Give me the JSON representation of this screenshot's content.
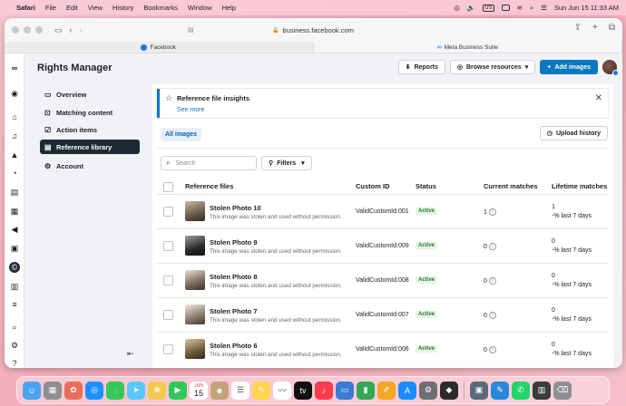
{
  "menubar": {
    "app": "Safari",
    "items": [
      "File",
      "Edit",
      "View",
      "History",
      "Bookmarks",
      "Window",
      "Help"
    ],
    "datetime": "Sun Jun 15  11:33 AM"
  },
  "browser": {
    "url": "business.facebook.com",
    "tabs": [
      "Facebook",
      "Meta Business Suite"
    ]
  },
  "app": {
    "title": "Rights Manager",
    "nav": [
      "Overview",
      "Matching content",
      "Action items",
      "Reference library",
      "Account"
    ],
    "actions": {
      "reports": "Reports",
      "browse": "Browse resources",
      "add": "Add images"
    }
  },
  "insight": {
    "title": "Reference file insights",
    "link": "See more"
  },
  "filters": {
    "chip": "All images",
    "upload": "Upload history",
    "search_placeholder": "Search",
    "filters": "Filters"
  },
  "table": {
    "headers": [
      "Reference files",
      "Custom ID",
      "Status",
      "Current matches",
      "Lifetime matches"
    ],
    "rows": [
      {
        "title": "Stolen Photo 10",
        "desc": "This image was stolen and used without permission.",
        "id": "ValidCustomId:001",
        "status": "Active",
        "current": "1",
        "lifetime": "1",
        "trend": "-% last 7 days"
      },
      {
        "title": "Stolen Photo 9",
        "desc": "This image was stolen and used without permission.",
        "id": "ValidCustomId:009",
        "status": "Active",
        "current": "0",
        "lifetime": "0",
        "trend": "-% last 7 days"
      },
      {
        "title": "Stolen Photo 8",
        "desc": "This image was stolen and used without permission.",
        "id": "ValidCustomId:008",
        "status": "Active",
        "current": "0",
        "lifetime": "0",
        "trend": "-% last 7 days"
      },
      {
        "title": "Stolen Photo 7",
        "desc": "This image was stolen and used without permission.",
        "id": "ValidCustomId:007",
        "status": "Active",
        "current": "0",
        "lifetime": "0",
        "trend": "-% last 7 days"
      },
      {
        "title": "Stolen Photo 6",
        "desc": "This image was stolen and used without permission.",
        "id": "ValidCustomId:006",
        "status": "Active",
        "current": "0",
        "lifetime": "0",
        "trend": "-% last 7 days"
      }
    ]
  },
  "dock": {
    "calendar_month": "JUN",
    "calendar_day": "15"
  }
}
